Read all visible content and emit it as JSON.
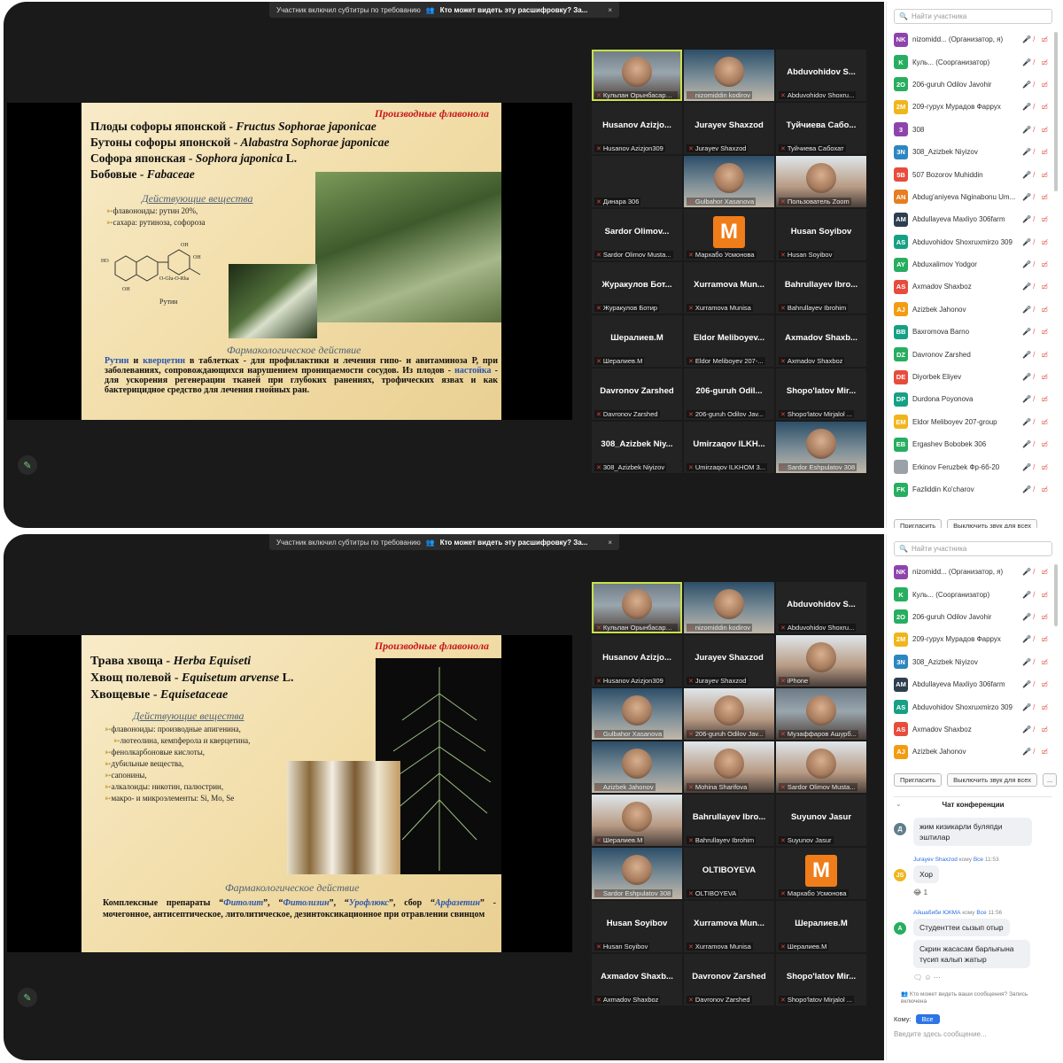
{
  "screen1": {
    "topbar": {
      "caption_note": "Участник включил субтитры по требованию",
      "who_can_see": "Кто может видеть эту расшифровку? За...",
      "close": "×"
    },
    "slide": {
      "section": "Производные флавонола",
      "lines": [
        {
          "ru": "Плоды софоры японской - ",
          "lat": "Fructus Sophorae japonicae"
        },
        {
          "ru": "Бутоны софоры японской - ",
          "lat": "Alabastra Sophorae japonicae"
        },
        {
          "ru": "Софора японская - ",
          "lat": "Sophora japonica",
          "suffix": " L."
        },
        {
          "ru": "Бобовые - ",
          "lat": "Fabaceae"
        }
      ],
      "active_head": "Действующие вещества",
      "active_items": [
        "флавоноиды: рутин 20%,",
        "сахара: рутиноза, софороза"
      ],
      "molecule_label": "Рутин",
      "pharm_head": "Фармакологическое действие",
      "pharm_w1": "Рутин",
      "pharm_and": " и ",
      "pharm_w2": "кверцетин",
      "pharm_mid": " в таблетках - для профилактики и лечения гипо- и авитаминоза Р, при заболеваниях, сопровождающихся нарушением проницаемости сосудов. Из плодов - ",
      "pharm_w3": "настойка",
      "pharm_end": " - для ускорения регенерации тканей при глубоких ранениях, трофических язвах и как бактерицидное средство для лечения гнойных ран."
    },
    "tiles": [
      {
        "name": "",
        "label": "Кульпан Орынбасарова",
        "video": "video",
        "active": true
      },
      {
        "name": "",
        "label": "nizomiddin kodirov",
        "video": "video2"
      },
      {
        "name": "Abduvohidov S...",
        "label": "Abduvohidov Shoxru..."
      },
      {
        "name": "Husanov Azizjo...",
        "label": "Husanov Azizjon309"
      },
      {
        "name": "Jurayev Shaxzod",
        "label": "Jurayev Shaxzod"
      },
      {
        "name": "Туйчиева Сабо...",
        "label": "Туйчиева Сабохат"
      },
      {
        "name": "",
        "label": "Динара 306"
      },
      {
        "name": "",
        "label": "Gulbahor Xasanova",
        "video": "video2"
      },
      {
        "name": "",
        "label": "Пользователь Zoom",
        "video": "video3"
      },
      {
        "name": "Sardor Olimov...",
        "label": "Sardor Olimov Musta..."
      },
      {
        "name": "",
        "label": "Мархабо Усмонова",
        "m": "M"
      },
      {
        "name": "Husan Soyibov",
        "label": "Husan Soyibov"
      },
      {
        "name": "Журакулов Бот...",
        "label": "Журакулов Ботир"
      },
      {
        "name": "Xurramova Mun...",
        "label": "Xurramova Munisa"
      },
      {
        "name": "Bahrullayev Ibro...",
        "label": "Bahrullayev Ibrohim"
      },
      {
        "name": "Шералиев.М",
        "label": "Шералиев.М"
      },
      {
        "name": "Eldor Meliboyev...",
        "label": "Eldor Meliboyev 207-..."
      },
      {
        "name": "Axmadov Shaxb...",
        "label": "Axmadov Shaxboz"
      },
      {
        "name": "Davronov Zarshed",
        "label": "Davronov Zarshed"
      },
      {
        "name": "206-guruh Odil...",
        "label": "206-guruh Odilov Jav..."
      },
      {
        "name": "Shopo'latov Mir...",
        "label": "Shopo'latov Mirjalol ..."
      },
      {
        "name": "308_Azizbek Niy...",
        "label": "308_Azizbek Niyizov"
      },
      {
        "name": "Umirzaqov ILKH...",
        "label": "Umirzaqov ILKHOM 3..."
      },
      {
        "name": "",
        "label": "Sardor Eshpulatov 308",
        "video": "video2"
      }
    ],
    "panel": {
      "search": "Найти участника",
      "participants": [
        {
          "ab": "NK",
          "c": "#8e44ad",
          "n": "nizomidd... (Организатор, я)"
        },
        {
          "ab": "K",
          "c": "#27ae60",
          "n": "Куль... (Соорганизатор)"
        },
        {
          "ab": "2O",
          "c": "#27ae60",
          "n": "206-guruh Odilov Javohir"
        },
        {
          "ab": "2M",
          "c": "#f1b51c",
          "n": "209-гурух Мурадов Фаррух"
        },
        {
          "ab": "3",
          "c": "#8e44ad",
          "n": "308"
        },
        {
          "ab": "3N",
          "c": "#2e86c1",
          "n": "308_Azizbek Niyizov"
        },
        {
          "ab": "5B",
          "c": "#e74c3c",
          "n": "507 Bozorov Muhiddin"
        },
        {
          "ab": "AN",
          "c": "#e67e22",
          "n": "Abdug'aniyeva Niginabonu Um..."
        },
        {
          "ab": "AM",
          "c": "#2c3e50",
          "n": "Abdullayeva Maxliyo 306farm"
        },
        {
          "ab": "AS",
          "c": "#16a085",
          "n": "Abduvohidov Shoxruxmirzo 309"
        },
        {
          "ab": "AY",
          "c": "#27ae60",
          "n": "Abduxalimov Yodgor"
        },
        {
          "ab": "AS",
          "c": "#e74c3c",
          "n": "Axmadov Shaxboz"
        },
        {
          "ab": "AJ",
          "c": "#f39c12",
          "n": "Azizbek Jahonov"
        },
        {
          "ab": "BB",
          "c": "#16a085",
          "n": "Baxromova Barno"
        },
        {
          "ab": "DZ",
          "c": "#27ae60",
          "n": "Davronov Zarshed"
        },
        {
          "ab": "DE",
          "c": "#e74c3c",
          "n": "Diyorbek Eliyev"
        },
        {
          "ab": "DP",
          "c": "#16a085",
          "n": "Durdona Poyonova"
        },
        {
          "ab": "EM",
          "c": "#f1b51c",
          "n": "Eldor Meliboyev 207-group"
        },
        {
          "ab": "EB",
          "c": "#27ae60",
          "n": "Ergashev Bobobek 306"
        },
        {
          "ab": "",
          "c": "#9aa1a8",
          "n": "Erkinov Feruzbek Фр-6б-20"
        },
        {
          "ab": "FK",
          "c": "#27ae60",
          "n": "Fazliddin Ko'charov"
        }
      ],
      "invite": "Пригласить",
      "mute_all": "Выключить звук для всех"
    }
  },
  "screen2": {
    "topbar": {
      "caption_note": "Участник включил субтитры по требованию",
      "who_can_see": "Кто может видеть эту расшифровку? За...",
      "close": "×"
    },
    "slide": {
      "section": "Производные флавонола",
      "lines": [
        {
          "ru": "Трава хвоща - ",
          "lat": "Herba Equiseti"
        },
        {
          "ru": "Хвощ полевой - ",
          "lat": "Equisetum arvense",
          "suffix": " L."
        },
        {
          "ru": "Хвощевые - ",
          "lat": "Equisetaceae"
        }
      ],
      "active_head": "Действующие вещества",
      "active_items": [
        "флавоноиды: производные апигенина,",
        "лютеолина, кемпферола и кверцетина,",
        "фенолкарбоновые кислоты,",
        "дубильные вещества,",
        "сапонины,",
        "алкалоиды: никотин, палюстрин,",
        "макро- и микроэлементы: Si, Mo, Se"
      ],
      "pharm_head": "Фармакологическое действие",
      "pharm_a": "Комплексные препараты “",
      "pharm_b": "Фитолит",
      "pharm_c": "”, “",
      "pharm_d": "Фитолизин",
      "pharm_e": "”, “",
      "pharm_f": "Урофлюкс",
      "pharm_g": "”, сбор “",
      "pharm_h": "Арфазетин",
      "pharm_i": "” - мочегонное, антисептическое, литолитическое, дезинтоксикационное при отравлении свинцом"
    },
    "tiles": [
      {
        "name": "",
        "label": "Кульпан Орынбасарова",
        "video": "video",
        "active": true
      },
      {
        "name": "",
        "label": "nizomiddin kodirov",
        "video": "video2"
      },
      {
        "name": "Abduvohidov S...",
        "label": "Abduvohidov Shoxru..."
      },
      {
        "name": "Husanov Azizjo...",
        "label": "Husanov Azizjon309"
      },
      {
        "name": "Jurayev Shaxzod",
        "label": "Jurayev Shaxzod"
      },
      {
        "name": "",
        "label": "iPhone",
        "video": "video3"
      },
      {
        "name": "",
        "label": "Gulbahor Xasanova",
        "video": "video2"
      },
      {
        "name": "",
        "label": "206-guruh Odilov Jav...",
        "video": "video3"
      },
      {
        "name": "",
        "label": "Музаффаров Ашурб...",
        "video": "video"
      },
      {
        "name": "",
        "label": "Azizbek Jahonov",
        "video": "video2"
      },
      {
        "name": "",
        "label": "Mohina Sharifova",
        "video": "video3"
      },
      {
        "name": "",
        "label": "Sardor Olimov Musta...",
        "video": "video3"
      },
      {
        "name": "",
        "label": "Шералиев.М",
        "video": "video3"
      },
      {
        "name": "Bahrullayev Ibro...",
        "label": "Bahrullayev Ibrohim"
      },
      {
        "name": "Suyunov Jasur",
        "label": "Suyunov Jasur"
      },
      {
        "name": "",
        "label": "Sardor Eshpulatov 308",
        "video": "video2"
      },
      {
        "name": "OLTIBOYEVA",
        "label": "OLTIBOYEVA"
      },
      {
        "name": "",
        "label": "Мархабо Усмонова",
        "m": "M"
      },
      {
        "name": "Husan Soyibov",
        "label": "Husan Soyibov"
      },
      {
        "name": "Xurramova Mun...",
        "label": "Xurramova Munisa"
      },
      {
        "name": "Шералиев.М",
        "label": "Шералиев.М"
      },
      {
        "name": "Axmadov Shaxb...",
        "label": "Axmadov Shaxboz"
      },
      {
        "name": "Davronov Zarshed",
        "label": "Davronov Zarshed"
      },
      {
        "name": "Shopo'latov Mir...",
        "label": "Shopo'latov Mirjalol ..."
      }
    ],
    "panel": {
      "search": "Найти участника",
      "participants": [
        {
          "ab": "NK",
          "c": "#8e44ad",
          "n": "nizomidd... (Организатор, я)"
        },
        {
          "ab": "K",
          "c": "#27ae60",
          "n": "Куль... (Соорганизатор)"
        },
        {
          "ab": "2O",
          "c": "#27ae60",
          "n": "206-guruh Odilov Javohir"
        },
        {
          "ab": "2M",
          "c": "#f1b51c",
          "n": "209-гурух Мурадов Фаррух"
        },
        {
          "ab": "3N",
          "c": "#2e86c1",
          "n": "308_Azizbek Niyizov"
        },
        {
          "ab": "AM",
          "c": "#2c3e50",
          "n": "Abdullayeva Maxliyo 306farm"
        },
        {
          "ab": "AS",
          "c": "#16a085",
          "n": "Abduvohidov Shoxruxmirzo 309"
        },
        {
          "ab": "AS",
          "c": "#e74c3c",
          "n": "Axmadov Shaxboz"
        },
        {
          "ab": "AJ",
          "c": "#f39c12",
          "n": "Azizbek Jahonov"
        }
      ],
      "invite": "Пригласить",
      "mute_all": "Выключить звук для всех",
      "more": "...",
      "chat": {
        "title": "Чат конференции",
        "m1_text": "жим кизикарли буляпди эштилар",
        "m1_av": "Д",
        "m2_from": "Jurayev Shaxzod",
        "m2_to": "кому",
        "m2_all": "Все",
        "m2_time": "11:53",
        "m2_av": "JS",
        "m2_text": "Хор",
        "m2_react": "😂 1",
        "m3_from": "Айшабиби ЮКМА",
        "m3_to": "кому",
        "m3_all": "Все",
        "m3_time": "11:56",
        "m3_av": "А",
        "m3_text1": "Студенттеи сызып отыр",
        "m3_text2": "Скрин жасасам барлығына түсип калып жатыр",
        "note": "Кто может видеть ваши сообщения? Запись включена",
        "to_label": "Кому:",
        "to_value": "Все",
        "placeholder": "Введите здесь сообщение..."
      }
    }
  }
}
